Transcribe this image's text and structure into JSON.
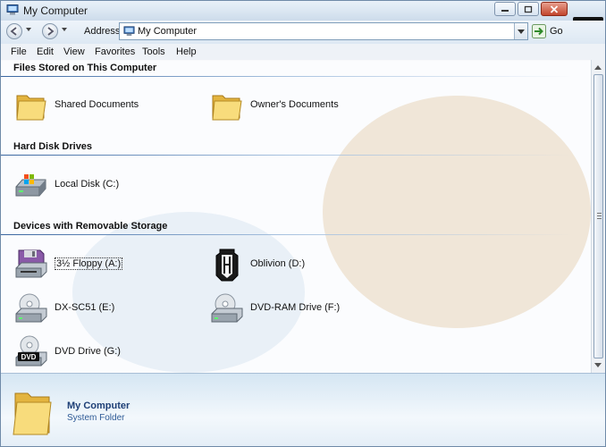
{
  "window": {
    "title": "My Computer"
  },
  "address": {
    "label": "Address",
    "value": "My Computer",
    "go_label": "Go"
  },
  "menu": [
    "File",
    "Edit",
    "View",
    "Favorites",
    "Tools",
    "Help"
  ],
  "sections": {
    "files": {
      "heading": "Files Stored on This Computer",
      "items": [
        "Shared Documents",
        "Owner's Documents"
      ]
    },
    "hdd": {
      "heading": "Hard Disk Drives",
      "items": [
        "Local Disk (C:)"
      ]
    },
    "removable": {
      "heading": "Devices with Removable Storage",
      "items": [
        "3½ Floppy (A:)",
        "Oblivion (D:)",
        "DX-SC51 (E:)",
        "DVD-RAM Drive (F:)",
        "DVD Drive (G:)"
      ],
      "dvd_badge": "DVD"
    }
  },
  "details": {
    "title": "My Computer",
    "subtitle": "System Folder"
  },
  "icons": {
    "folder": "folder-icon",
    "hdd": "hard-disk-icon",
    "floppy": "floppy-icon",
    "game": "oblivion-disc-icon",
    "cd": "cd-drive-icon",
    "dvd": "dvd-drive-icon"
  },
  "colors": {
    "accent": "#1e3f76",
    "link": "#2d5a96",
    "divider": "#3a66a0"
  }
}
